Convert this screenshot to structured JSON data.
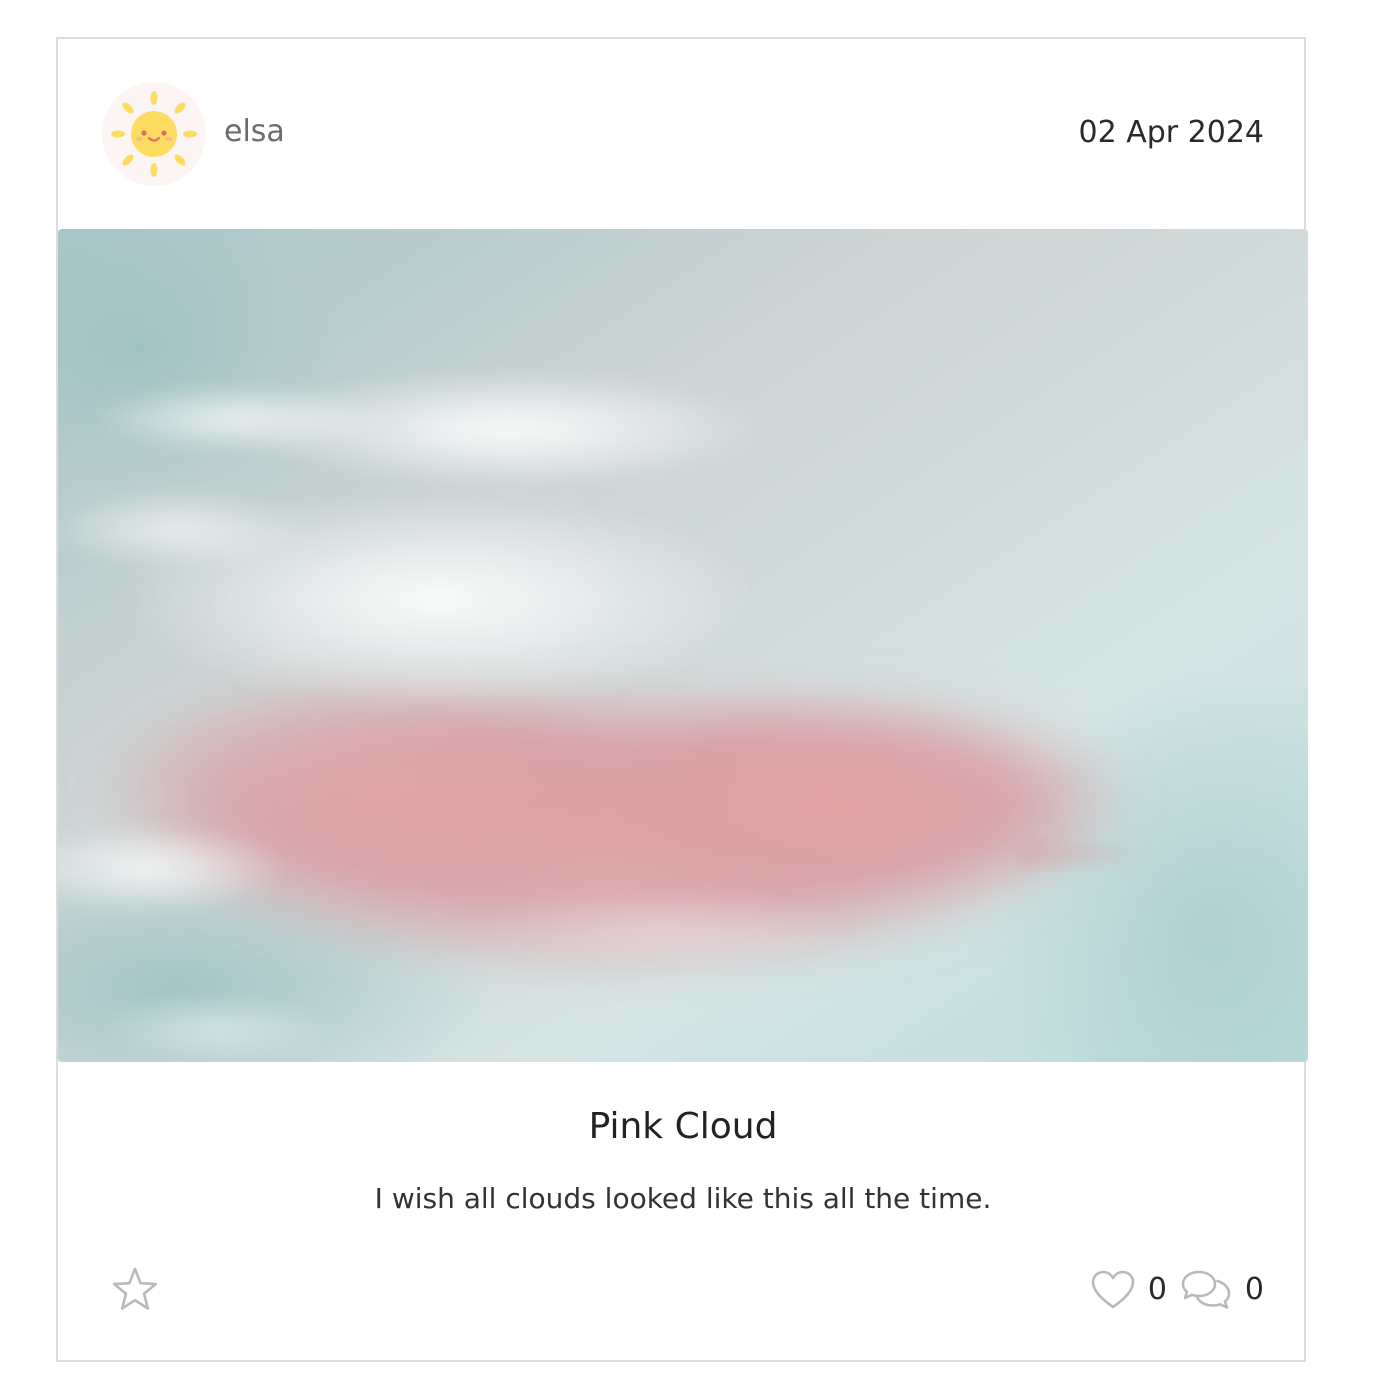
{
  "post": {
    "author": {
      "name": "elsa",
      "avatar_icon": "sun-face-icon"
    },
    "date": "02 Apr 2024",
    "image": {
      "subject": "pink cloud in pale sky"
    },
    "title": "Pink Cloud",
    "description": "I wish all clouds looked like this all the time."
  },
  "actions": {
    "favorite_icon": "star-outline-icon",
    "like_icon": "heart-outline-icon",
    "likes": "0",
    "comment_icon": "speech-bubbles-icon",
    "comments": "0"
  },
  "colors": {
    "card_border": "#dcdcdc",
    "sun": "#fddc62",
    "avatar_bg": "#fdf4f4",
    "sky": "#c9e2e2",
    "cloud_pink": "#e3a4a8",
    "icon_gray": "#b9b9b9"
  }
}
